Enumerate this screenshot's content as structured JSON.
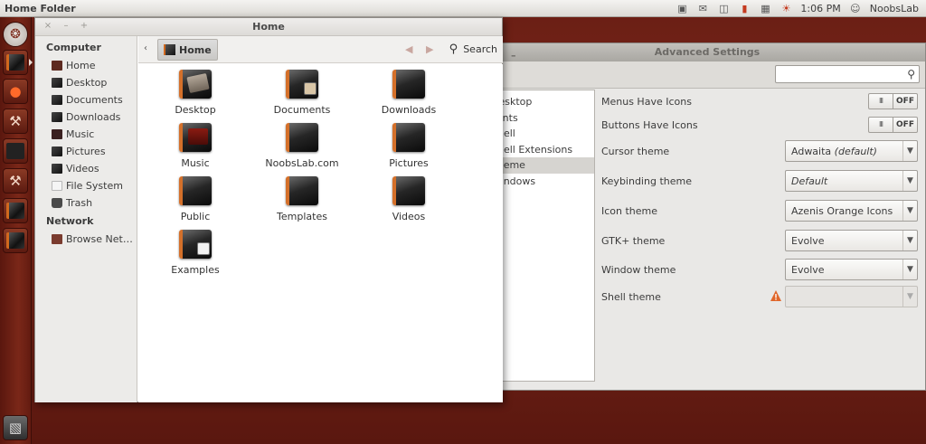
{
  "top_panel": {
    "title": "Home Folder",
    "clock": "1:06 PM",
    "user": "NoobsLab"
  },
  "launcher": {
    "items": [
      "ubuntu-logo-icon",
      "files-icon",
      "browser-icon",
      "tools-icon",
      "terminal-icon",
      "settings-tools-icon",
      "folder-icon",
      "folder-icon",
      "trash-icon"
    ]
  },
  "file_manager": {
    "title": "Home",
    "window_buttons": {
      "close": "×",
      "minimize": "–",
      "maximize": "+"
    },
    "sidebar": {
      "computer_label": "Computer",
      "computer_items": [
        {
          "label": "Home",
          "icon": "home-icon"
        },
        {
          "label": "Desktop",
          "icon": "desktop-icon"
        },
        {
          "label": "Documents",
          "icon": "documents-icon"
        },
        {
          "label": "Downloads",
          "icon": "downloads-icon"
        },
        {
          "label": "Music",
          "icon": "music-icon"
        },
        {
          "label": "Pictures",
          "icon": "pictures-icon"
        },
        {
          "label": "Videos",
          "icon": "videos-icon"
        },
        {
          "label": "File System",
          "icon": "filesystem-icon"
        },
        {
          "label": "Trash",
          "icon": "trash-icon"
        }
      ],
      "network_label": "Network",
      "network_items": [
        {
          "label": "Browse Net…",
          "icon": "network-icon"
        }
      ]
    },
    "toolbar": {
      "back": "‹",
      "breadcrumb": "Home",
      "search_label": "Search"
    },
    "folders": [
      {
        "label": "Desktop",
        "emblem": "desktop"
      },
      {
        "label": "Documents",
        "emblem": "docs"
      },
      {
        "label": "Downloads",
        "emblem": ""
      },
      {
        "label": "Music",
        "emblem": "music"
      },
      {
        "label": "NoobsLab.com",
        "emblem": ""
      },
      {
        "label": "Pictures",
        "emblem": ""
      },
      {
        "label": "Public",
        "emblem": ""
      },
      {
        "label": "Templates",
        "emblem": ""
      },
      {
        "label": "Videos",
        "emblem": ""
      },
      {
        "label": "Examples",
        "emblem": "examples"
      }
    ]
  },
  "advanced_settings": {
    "title": "Advanced Settings",
    "list": [
      {
        "label": "Desktop",
        "selected": false
      },
      {
        "label": "Fonts",
        "selected": false
      },
      {
        "label": "Shell",
        "selected": false
      },
      {
        "label": "Shell Extensions",
        "selected": false
      },
      {
        "label": "Theme",
        "selected": true
      },
      {
        "label": "Windows",
        "selected": false
      }
    ],
    "settings": {
      "menus_have_icons": {
        "label": "Menus Have Icons",
        "knob": "III",
        "state": "OFF"
      },
      "buttons_have_icons": {
        "label": "Buttons Have Icons",
        "knob": "III",
        "state": "OFF"
      },
      "cursor_theme": {
        "label": "Cursor theme",
        "value": "Adwaita",
        "suffix": "(default)"
      },
      "keybinding_theme": {
        "label": "Keybinding theme",
        "value": "Default"
      },
      "icon_theme": {
        "label": "Icon theme",
        "value": "Azenis Orange Icons"
      },
      "gtk_theme": {
        "label": "GTK+ theme",
        "value": "Evolve"
      },
      "window_theme": {
        "label": "Window theme",
        "value": "Evolve"
      },
      "shell_theme": {
        "label": "Shell theme",
        "value": ""
      }
    }
  },
  "colors": {
    "accent": "#d4702a",
    "wallpaper": "#6a1e14",
    "warning": "#e0662a"
  }
}
